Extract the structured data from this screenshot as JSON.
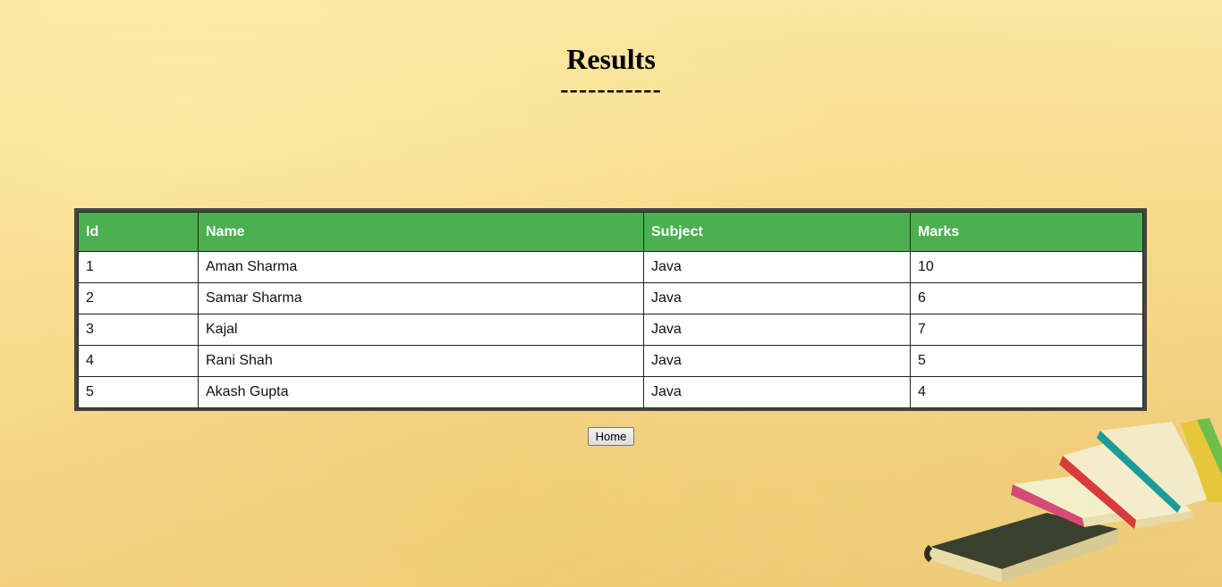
{
  "page": {
    "title": "Results",
    "divider": "-----------"
  },
  "table": {
    "headers": {
      "id": "Id",
      "name": "Name",
      "subject": "Subject",
      "marks": "Marks"
    },
    "rows": [
      {
        "id": "1",
        "name": "Aman Sharma",
        "subject": "Java",
        "marks": "10"
      },
      {
        "id": "2",
        "name": "Samar Sharma",
        "subject": "Java",
        "marks": "6"
      },
      {
        "id": "3",
        "name": "Kajal",
        "subject": "Java",
        "marks": "7"
      },
      {
        "id": "4",
        "name": "Rani Shah",
        "subject": "Java",
        "marks": "5"
      },
      {
        "id": "5",
        "name": "Akash Gupta",
        "subject": "Java",
        "marks": "4"
      }
    ]
  },
  "actions": {
    "home_label": "Home"
  },
  "colors": {
    "header_green": "#4caf50",
    "background": "#f7da8e"
  },
  "decor": {
    "image": "stack-of-books-icon"
  }
}
